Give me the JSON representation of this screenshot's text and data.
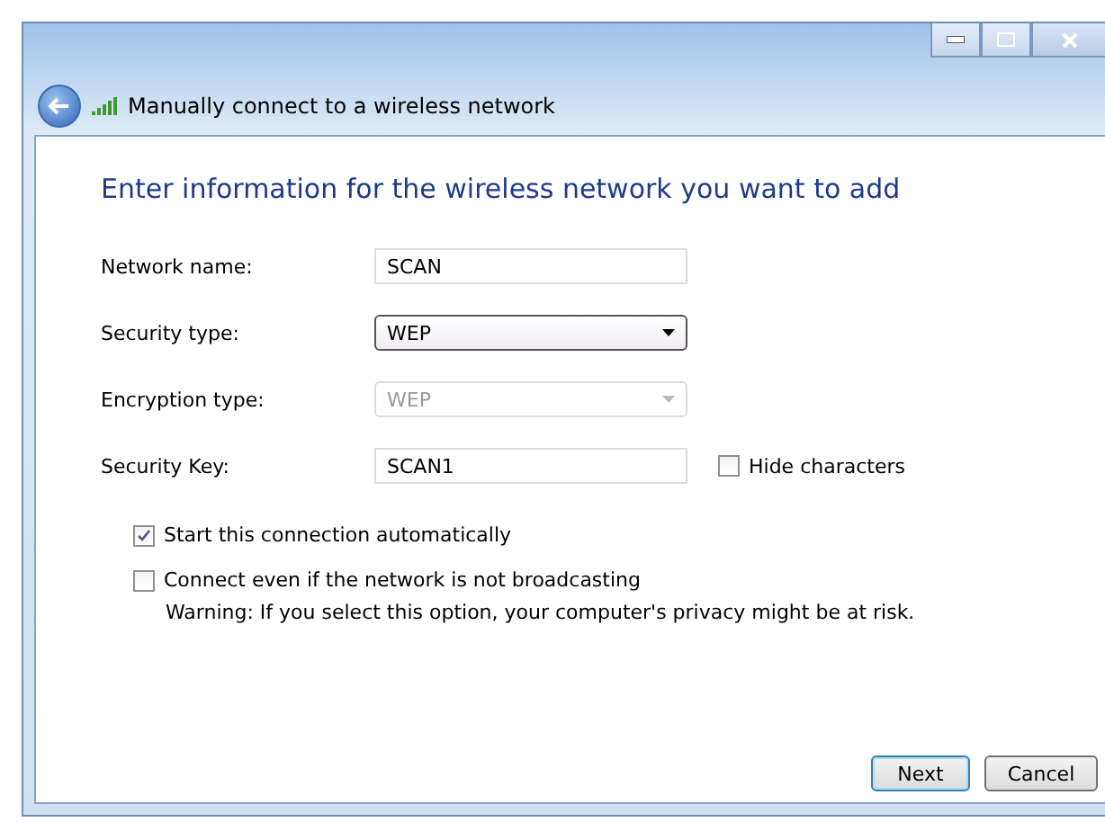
{
  "window": {
    "title": "Manually connect to a wireless network"
  },
  "heading": "Enter information for the wireless network you want to add",
  "fields": [
    {
      "label": "Network name:",
      "kind": "text",
      "value": "SCAN",
      "disabled": false
    },
    {
      "label": "Security type:",
      "kind": "dropdown",
      "value": "WEP",
      "disabled": false
    },
    {
      "label": "Encryption type:",
      "kind": "dropdown",
      "value": "WEP",
      "disabled": true
    },
    {
      "label": "Security Key:",
      "kind": "text",
      "value": "SCAN1",
      "disabled": false,
      "option": {
        "label": "Hide characters",
        "checked": false
      }
    }
  ],
  "options": [
    {
      "label": "Start this connection automatically",
      "checked": true
    },
    {
      "label": "Connect even if the network is not broadcasting",
      "checked": false,
      "note": "Warning: If you select this option, your computer's privacy might be at risk."
    }
  ],
  "buttons": [
    {
      "label": "Next",
      "default": true
    },
    {
      "label": "Cancel",
      "default": false
    }
  ]
}
